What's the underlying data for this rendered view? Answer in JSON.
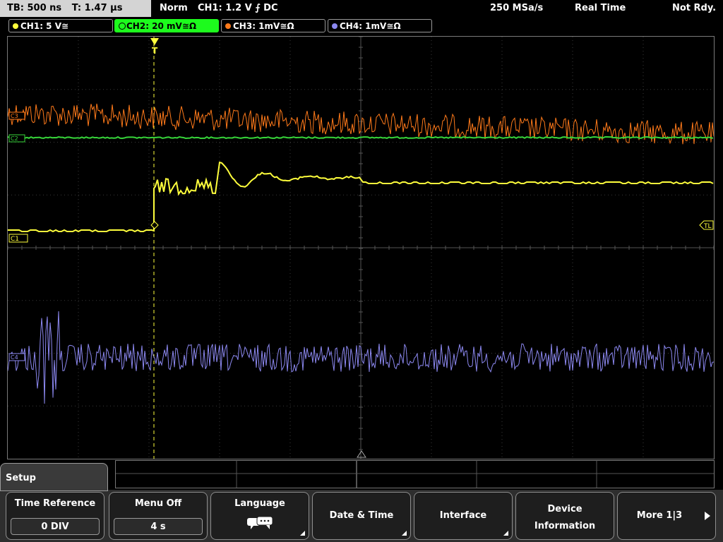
{
  "status": {
    "timebase": "TB: 500 ns",
    "trigger_time": "T: 1.47 µs",
    "mode": "Norm",
    "trigger": "CH1: 1.2 V ⨍ DC",
    "sample_rate": "250 MSa/s",
    "acq_mode": "Real Time",
    "ready_state": "Not Rdy."
  },
  "channels": [
    {
      "label": "CH1: 5 V≅",
      "color": "#ffff3c"
    },
    {
      "label": "CH2: 20 mV≅Ω",
      "color": "#37d63a"
    },
    {
      "label": "CH3: 1mV≅Ω",
      "color": "#ff7a1a"
    },
    {
      "label": "CH4: 1mV≅Ω",
      "color": "#8c88f0"
    }
  ],
  "markers": {
    "trigger_top": "T",
    "trigger_level": "TL",
    "ch1": "C1",
    "ch2": "C2",
    "ch3": "C3",
    "ch4": "C4"
  },
  "menu": {
    "title": "Setup",
    "softkeys": [
      {
        "label": "Time Reference",
        "value": "0 DIV"
      },
      {
        "label": "Menu Off",
        "value": "4 s"
      },
      {
        "label": "Language",
        "icon": "speech-bubble-icon"
      },
      {
        "label": "Date & Time"
      },
      {
        "label": "Interface"
      },
      {
        "label": "Device Information"
      },
      {
        "label": "More 1|3"
      }
    ]
  }
}
